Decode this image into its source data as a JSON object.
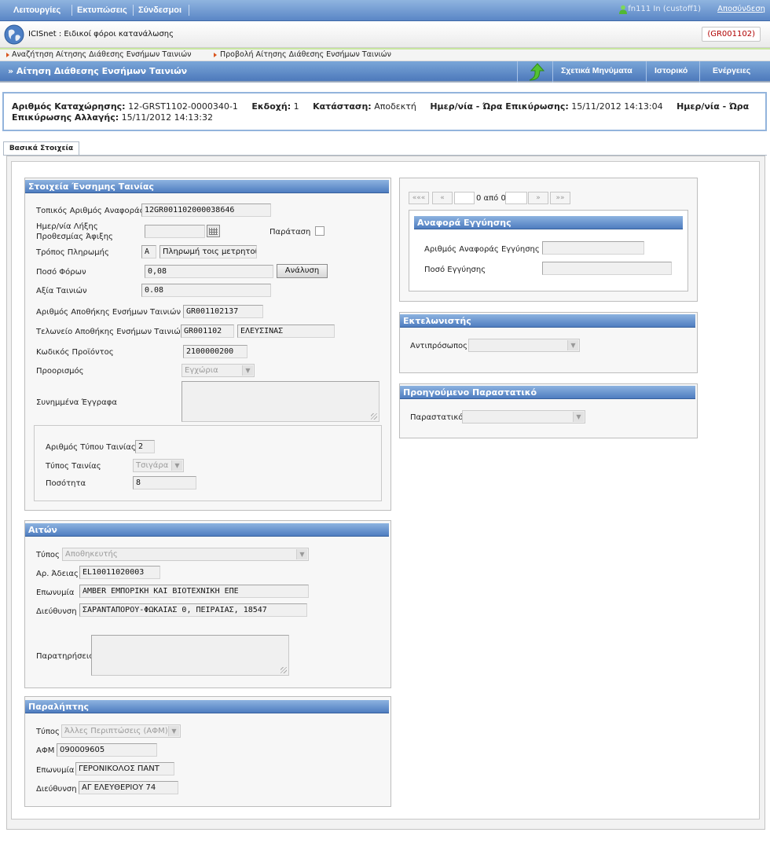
{
  "topbar": {
    "menu": [
      "Λειτουργίες",
      "Εκτυπώσεις",
      "Σύνδεσμοι"
    ],
    "user": "fn111 In (custoff1)",
    "logout": "Αποσύνδεση"
  },
  "app": {
    "title": "ICISnet : Ειδικοί φόροι κατανάλωσης",
    "office_code": "(GR001102)"
  },
  "breadcrumb": [
    "Αναζήτηση Αίτησης Διάθεσης Ενσήμων Ταινιών",
    "Προβολή Αίτησης Διάθεσης Ενσήμων Ταινιών"
  ],
  "page": {
    "title": "» Αίτηση Διάθεσης Ενσήμων Ταινιών",
    "actions": [
      "Σχετικά Μηνύματα",
      "Ιστορικό",
      "Ενέργειες"
    ]
  },
  "record": {
    "reg_label": "Αριθμός Καταχώρησης:",
    "reg_value": "12-GRST1102-0000340-1",
    "version_label": "Εκδοχή:",
    "version_value": "1",
    "status_label": "Κατάσταση:",
    "status_value": "Αποδεκτή",
    "confirm_label": "Ημερ/νία - Ώρα Επικύρωσης:",
    "confirm_value": "15/11/2012 14:13:04",
    "change_label": "Ημερ/νία - Ώρα Επικύρωσης Αλλαγής:",
    "change_value": "15/11/2012 14:13:32"
  },
  "tab": "Βασικά Στοιχεία",
  "stamp": {
    "title": "Στοιχεία Ένσημης Ταινίας",
    "local_ref_label": "Τοπικός Αριθμός Αναφοράς",
    "local_ref_value": "12GR001102000038646",
    "deadline_label_1": "Ημερ/νία Λήξης",
    "deadline_label_2": "Προθεσμίας Άφιξης",
    "deadline_value": "",
    "extension_label": "Παράταση",
    "payment_label": "Τρόπος Πληρωμής",
    "payment_code": "A",
    "payment_desc": "Πληρωμή τοις μετρητοίς",
    "tax_label": "Ποσό Φόρων",
    "tax_value": "0,08",
    "analysis_button": "Ανάλυση",
    "value_label": "Αξία Ταινιών",
    "value_value": "0.08",
    "warehouse_label": "Αριθμός Αποθήκης Ενσήμων Ταινιών",
    "warehouse_value": "GR001102137",
    "customs_label": "Τελωνείο Αποθήκης Ενσήμων Ταινιών",
    "customs_code": "GR001102",
    "customs_name": "ΕΛΕΥΣΙΝΑΣ",
    "product_label": "Κωδικός Προϊόντος",
    "product_value": "2100000200",
    "destination_label": "Προορισμός",
    "destination_value": "Εγχώρια",
    "attachments_label": "Συνημμένα Έγγραφα",
    "type_no_label": "Αριθμός Τύπου Ταινίας",
    "type_no_value": "2",
    "type_label": "Τύπος Ταινίας",
    "type_value": "Τσιγάρα",
    "qty_label": "Ποσότητα",
    "qty_value": "8"
  },
  "applicant": {
    "title": "Αιτών",
    "type_label": "Τύπος",
    "type_value": "Αποθηκευτής",
    "license_label": "Αρ. Άδειας",
    "license_value": "EL10011020003",
    "name_label": "Επωνυμία",
    "name_value": "AMBER ΕΜΠΟΡΙΚΗ ΚΑΙ ΒΙΟΤΕΧΝΙΚΗ ΕΠΕ",
    "address_label": "Διεύθυνση",
    "address_value": "ΣΑΡΑΝΤΑΠΟΡΟΥ-ΦΩΚΑΙΑΣ 0, ΠΕΙΡΑΙΑΣ, 18547",
    "notes_label": "Παρατηρήσεις"
  },
  "receiver": {
    "title": "Παραλήπτης",
    "type_label": "Τύπος",
    "type_value": "Άλλες Περιπτώσεις (ΑΦΜ)",
    "afm_label": "ΑΦΜ",
    "afm_value": "090009605",
    "name_label": "Επωνυμία",
    "name_value": "ΓΕΡΟΝΙΚΟΛΟΣ ΠΑΝΤ",
    "address_label": "Διεύθυνση",
    "address_value": "ΑΓ ΕΛΕΥΘΕΡΙΟΥ 74"
  },
  "pager": {
    "first": "«««",
    "prev": "«",
    "text": "0 από 0",
    "next": "»",
    "last": "»»"
  },
  "guarantee": {
    "title": "Αναφορά Εγγύησης",
    "ref_label": "Αριθμός Αναφοράς Εγγύησης",
    "ref_value": "",
    "amount_label": "Ποσό Εγγύησης",
    "amount_value": ""
  },
  "executor": {
    "title": "Εκτελωνιστής",
    "rep_label": "Αντιπρόσωπος",
    "rep_value": ""
  },
  "previous": {
    "title": "Προηγούμενο Παραστατικό",
    "doc_label": "Παραστατικό",
    "doc_value": ""
  }
}
